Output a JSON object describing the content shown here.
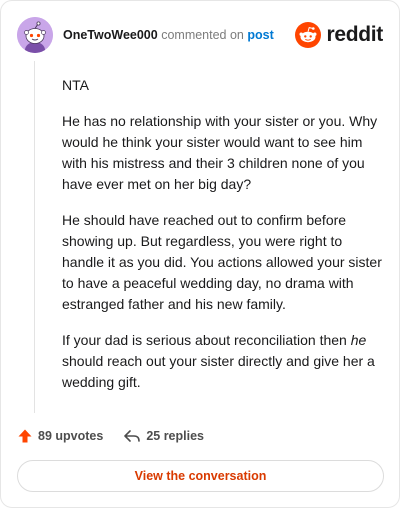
{
  "header": {
    "username": "OneTwoWee000",
    "action_text": "commented on",
    "post_link": "post",
    "brand": "reddit"
  },
  "comment": {
    "paragraphs": [
      "NTA",
      "He has no relationship with your sister or you. Why would he think your sister would want to see him with his mistress and their 3 children none of you have ever met on her big day?",
      "He should have reached out to confirm before showing up. But regardless, you were right to handle it as you did. You actions allowed your sister to have a peaceful wedding day, no drama with estranged father and his new family."
    ],
    "last_paragraph": {
      "before": "If your dad is serious about reconciliation then ",
      "emphasis": "he",
      "after": " should reach out your sister directly and give her a wedding gift."
    }
  },
  "actions": {
    "upvotes": "89 upvotes",
    "replies": "25 replies"
  },
  "cta": {
    "label": "View the conversation"
  },
  "colors": {
    "brand_orange": "#ff4500",
    "link_blue": "#0079d3",
    "cta_text": "#d93a00",
    "avatar_bg": "#c9a6e9"
  },
  "icons": [
    "avatar-snoo-icon",
    "reddit-snoo-icon",
    "upvote-arrow-icon",
    "reply-arrow-icon"
  ]
}
